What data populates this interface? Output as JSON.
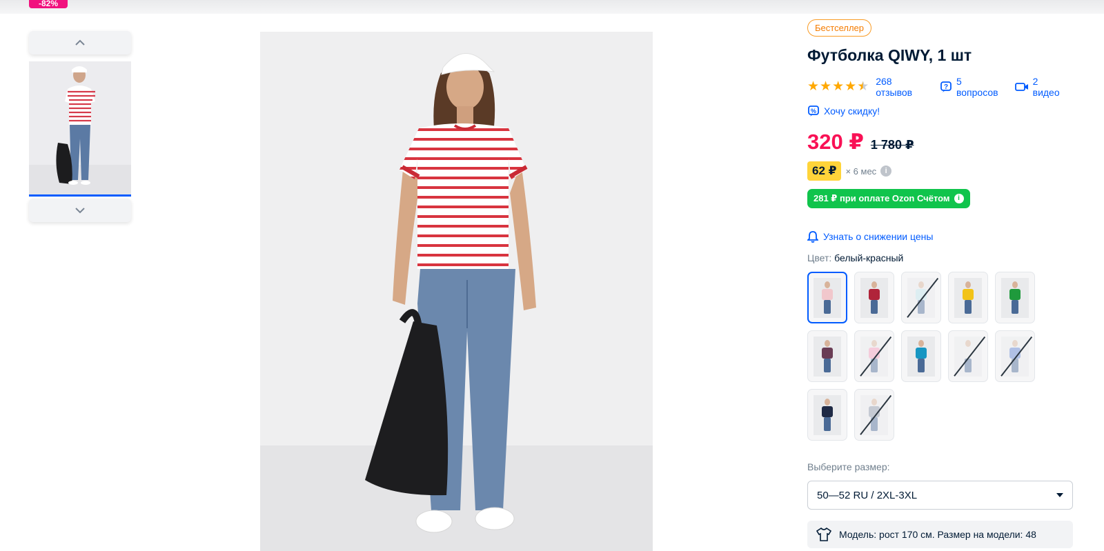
{
  "product": {
    "discount_badge": "-82%",
    "badge": "Бестселлер",
    "title": "Футболка QIWY, 1 шт",
    "rating_stars": 4.5,
    "reviews": "268 отзывов",
    "questions": "5 вопросов",
    "videos": "2 видео",
    "discount_request": "Хочу скидку!",
    "price": "320 ₽",
    "old_price": "1 780 ₽",
    "installment_amount": "62 ₽",
    "installment_term": "× 6 мес",
    "ozon_card_offer": "281 ₽ при оплате Ozon Счётом",
    "price_drop_notify": "Узнать о снижении цены",
    "color_label": "Цвет:",
    "color_value": "белый-красный",
    "size_label": "Выберите размер:",
    "size_value": "50—52 RU / 2XL-3XL",
    "model_info": "Модель: рост 170 см. Размер на модели: 48"
  },
  "swatches": [
    {
      "shirt": "#f1c7cc",
      "available": true,
      "selected": true
    },
    {
      "shirt": "#b0243a",
      "available": true,
      "selected": false
    },
    {
      "shirt": "#bfe6ee",
      "available": false,
      "selected": false
    },
    {
      "shirt": "#f2c318",
      "available": true,
      "selected": false
    },
    {
      "shirt": "#1f9a3c",
      "available": true,
      "selected": false
    },
    {
      "shirt": "#6a3d55",
      "available": true,
      "selected": false
    },
    {
      "shirt": "#f59abb",
      "available": false,
      "selected": false
    },
    {
      "shirt": "#1796c2",
      "available": true,
      "selected": false
    },
    {
      "shirt": "#ececec",
      "available": false,
      "selected": false
    },
    {
      "shirt": "#5c7fd0",
      "available": false,
      "selected": false
    },
    {
      "shirt": "#1f2a45",
      "available": true,
      "selected": false
    },
    {
      "shirt": "#8b97a8",
      "available": false,
      "selected": false
    }
  ],
  "colors": {
    "accent": "#005bff",
    "price": "#f91155",
    "bestseller": "#f99b24",
    "ozon_green": "#10c44c",
    "installment_bg": "#ffd43a"
  }
}
